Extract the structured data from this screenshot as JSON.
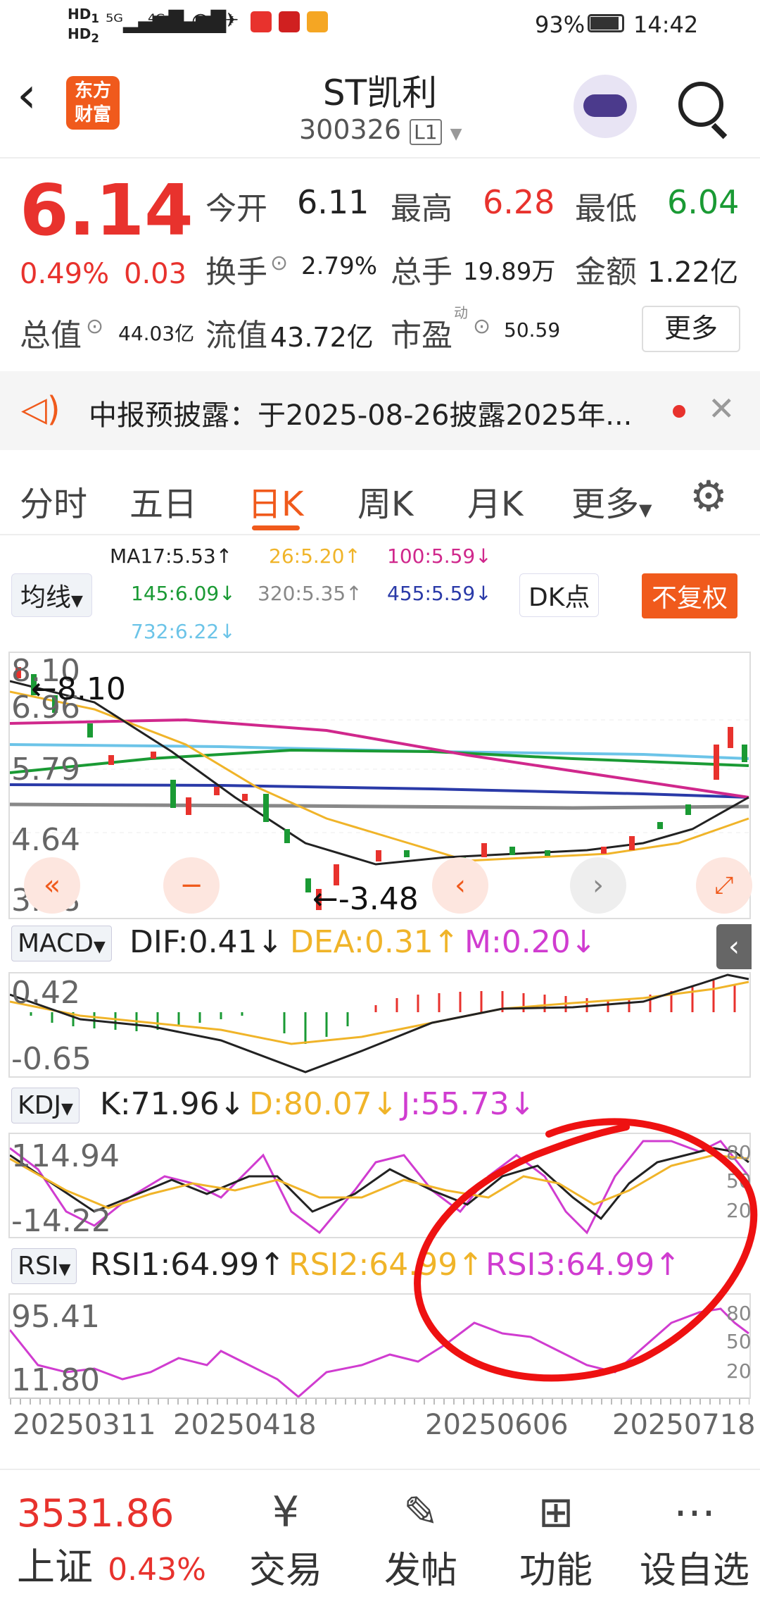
{
  "status_bar": {
    "left_icons": [
      "HD1",
      "HD2",
      "5G",
      "4G",
      "wifi",
      "nfc"
    ],
    "battery": "93%",
    "time": "14:42"
  },
  "header": {
    "logo": "东方财富",
    "stock_name": "ST凯利",
    "stock_code": "300326",
    "level_badge": "L1"
  },
  "quote": {
    "price": "6.14",
    "change_pct": "0.49%",
    "change": "0.03",
    "open_label": "今开",
    "open": "6.11",
    "high_label": "最高",
    "high": "6.28",
    "low_label": "最低",
    "low": "6.04",
    "turnover_label": "换手",
    "turnover": "2.79%",
    "volume_label": "总手",
    "volume": "19.89万",
    "amount_label": "金额",
    "amount": "1.22亿",
    "mktcap_label": "总值",
    "mktcap": "44.03亿",
    "float_label": "流值",
    "float_cap": "43.72亿",
    "pe_label": "市盈",
    "pe_sup": "动",
    "pe": "50.59",
    "more_button": "更多"
  },
  "notice": {
    "text": "中报预披露：于2025-08-26披露2025年..."
  },
  "tabs": [
    "分时",
    "五日",
    "日K",
    "周K",
    "月K",
    "更多"
  ],
  "active_tab": "日K",
  "ma_legend": {
    "selector": "均线",
    "ma17": "MA17:5.53↑",
    "ma26": "26:5.20↑",
    "ma100": "100:5.59↓",
    "ma145": "145:6.09↓",
    "ma320": "320:5.35↑",
    "ma455": "455:5.59↓",
    "ma732": "732:6.22↓",
    "dk_button": "DK点",
    "adjust_button": "不复权"
  },
  "kline": {
    "y_labels": [
      "8.10",
      "6.96",
      "5.79",
      "4.64",
      "3.48"
    ],
    "high_mark": "8.10",
    "low_mark": "-3.48"
  },
  "macd": {
    "selector": "MACD",
    "dif": "DIF:0.41↓",
    "dea": "DEA:0.31↑",
    "m": "M:0.20↓",
    "y_labels": [
      "0.42",
      "-0.65"
    ]
  },
  "kdj": {
    "selector": "KDJ",
    "k": "K:71.96↓",
    "d": "D:80.07↓",
    "j": "J:55.73↓",
    "y_labels": [
      "114.94",
      "-14.22"
    ],
    "levels": [
      "80",
      "50",
      "20"
    ]
  },
  "rsi": {
    "selector": "RSI",
    "rsi1": "RSI1:64.99↑",
    "rsi2": "RSI2:64.99↑",
    "rsi3": "RSI3:64.99↑",
    "y_labels": [
      "95.41",
      "11.80"
    ],
    "levels": [
      "80",
      "50",
      "20"
    ]
  },
  "dates": [
    "20250311",
    "20250418",
    "20250606",
    "20250718"
  ],
  "bottom": {
    "index_value": "3531.86",
    "index_name": "上证",
    "index_change": "0.43%",
    "trade": "交易",
    "post": "发帖",
    "function": "功能",
    "watchlist": "设自选"
  },
  "colors": {
    "up": "#e8322d",
    "down": "#1a9a34",
    "accent": "#f05a1c",
    "ma17": "#222222",
    "ma26": "#f0b429",
    "ma100": "#d0288c",
    "ma145": "#1a9a34",
    "ma320": "#888888",
    "ma455": "#2a3aa8",
    "ma732": "#6cc4e8"
  }
}
